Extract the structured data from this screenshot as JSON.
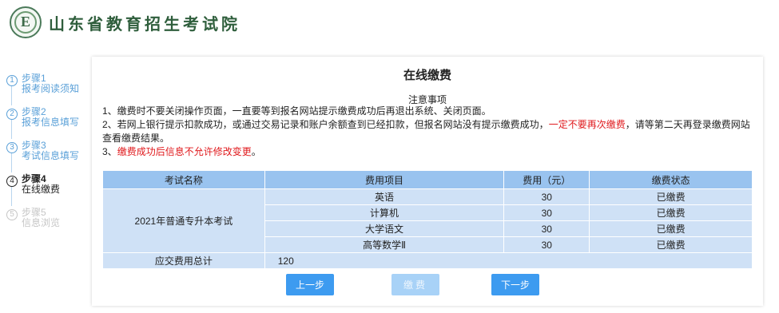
{
  "header": {
    "title": "山东省教育招生考试院",
    "logo_letter": "E"
  },
  "steps": [
    {
      "num": "1",
      "title": "步骤1",
      "desc": "报考阅读须知",
      "state": "done"
    },
    {
      "num": "2",
      "title": "步骤2",
      "desc": "报考信息填写",
      "state": "done"
    },
    {
      "num": "3",
      "title": "步骤3",
      "desc": "考试信息填写",
      "state": "done"
    },
    {
      "num": "4",
      "title": "步骤4",
      "desc": "在线缴费",
      "state": "current"
    },
    {
      "num": "5",
      "title": "步骤5",
      "desc": "信息浏览",
      "state": "future"
    }
  ],
  "main": {
    "title": "在线缴费",
    "notice_heading": "注意事项",
    "notice1": "1、缴费时不要关闭操作页面，一直要等到报名网站提示缴费成功后再退出系统、关闭页面。",
    "notice2_a": "2、若网上银行提示扣款成功，或通过交易记录和账户余额查到已经扣款，但报名网站没有提示缴费成功，",
    "notice2_red": "一定不要再次缴费",
    "notice2_b": "，请等第二天再登录缴费网站查看缴费结果。",
    "notice3_a": "3、",
    "notice3_red": "缴费成功后信息不允许修改变更",
    "notice3_b": "。"
  },
  "table": {
    "headers": [
      "考试名称",
      "费用项目",
      "费用（元）",
      "缴费状态"
    ],
    "exam_name": "2021年普通专升本考试",
    "rows": [
      {
        "item": "英语",
        "fee": "30",
        "status": "已缴费"
      },
      {
        "item": "计算机",
        "fee": "30",
        "status": "已缴费"
      },
      {
        "item": "大学语文",
        "fee": "30",
        "status": "已缴费"
      },
      {
        "item": "高等数学Ⅱ",
        "fee": "30",
        "status": "已缴费"
      }
    ],
    "total_label": "应交费用总计",
    "total_value": "120"
  },
  "buttons": {
    "prev": "上一步",
    "pay": "缴费",
    "next": "下一步"
  }
}
